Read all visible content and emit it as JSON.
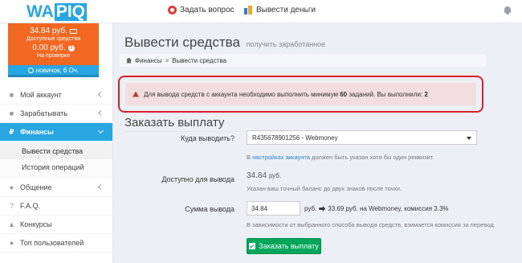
{
  "logo": {
    "part1": "WA",
    "part2": "PIQ"
  },
  "topbar": {
    "ask_label": "Задать вопрос",
    "withdraw_label": "Вывести деньги"
  },
  "sidebar": {
    "balance": "34.84 руб.",
    "balance_caption": "Доступные средства",
    "pending": "0.00 руб.",
    "pending_caption": "На проверке",
    "rank": "новичок, 6 Оч.",
    "items": [
      {
        "label": "Мой аккаунт",
        "icon": "user-icon"
      },
      {
        "label": "Зарабатывать",
        "icon": "briefcase-icon"
      },
      {
        "label": "Финансы",
        "icon": "ruble-icon"
      },
      {
        "label": "Общение",
        "icon": "chat-icon"
      },
      {
        "label": "F.A.Q.",
        "icon": "question-icon"
      },
      {
        "label": "Конкурсы",
        "icon": "trophy-icon"
      },
      {
        "label": "Топ пользователей",
        "icon": "users-icon"
      }
    ],
    "finance_sub": [
      {
        "label": "Вывести средства"
      },
      {
        "label": "История операций"
      }
    ]
  },
  "main": {
    "title": "Вывести средства",
    "subtitle": "получить заработанное",
    "breadcrumb": {
      "root": "Финансы",
      "current": "Вывести средства"
    },
    "alert": {
      "text_before": "Для вывода средств с аккаунта необходимо выполнить минимум ",
      "min_tasks": "60",
      "text_middle": " заданий. Вы выполнили: ",
      "done_tasks": "2"
    },
    "form": {
      "title": "Заказать выплату",
      "dest_label": "Куда выводить?",
      "dest_value": "R435678901256 - Webmoney",
      "dest_help_before": "В ",
      "dest_help_link": "настройках аккаунта",
      "dest_help_after": " должен быть указан хотя бы один реквизит.",
      "available_label": "Доступно для вывода",
      "available_value": "34.84",
      "available_unit": "руб.",
      "available_help": "Указан ваш точный баланс до двух знаков после точки.",
      "amount_label": "Сумма вывода",
      "amount_value": "34.84",
      "amount_unit": "руб.",
      "conversion": "33.69 руб. на Webmoney, комиссия 3.3%",
      "amount_help": "В зависимости от выбранного способа вывода средств, взимается комиссия за перевод.",
      "submit_label": "Заказать выплату"
    }
  }
}
